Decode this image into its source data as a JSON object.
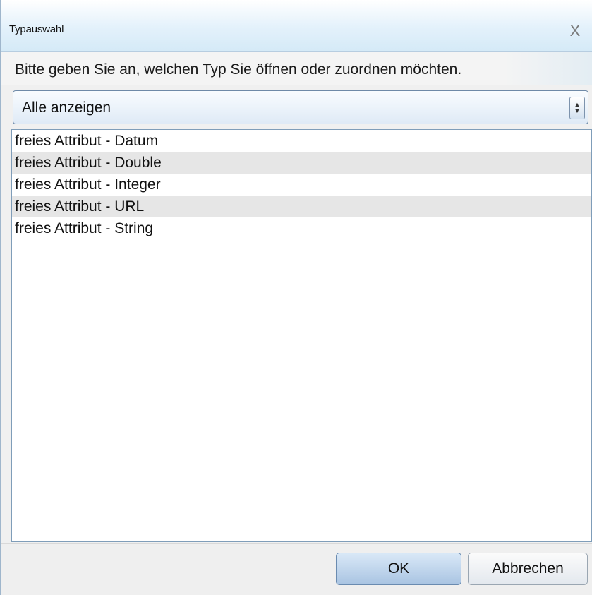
{
  "dialog": {
    "title": "Typauswahl",
    "close_symbol": "X",
    "prompt": "Bitte geben Sie an, welchen Typ Sie öffnen oder zuordnen möchten."
  },
  "filter": {
    "selected": "Alle anzeigen",
    "icon": "spinner-arrows-icon"
  },
  "types": [
    {
      "label": "freies Attribut - Datum"
    },
    {
      "label": "freies Attribut - Double"
    },
    {
      "label": "freies Attribut - Integer"
    },
    {
      "label": "freies Attribut - URL"
    },
    {
      "label": "freies Attribut - String"
    }
  ],
  "buttons": {
    "ok": "OK",
    "cancel": "Abbrechen"
  }
}
